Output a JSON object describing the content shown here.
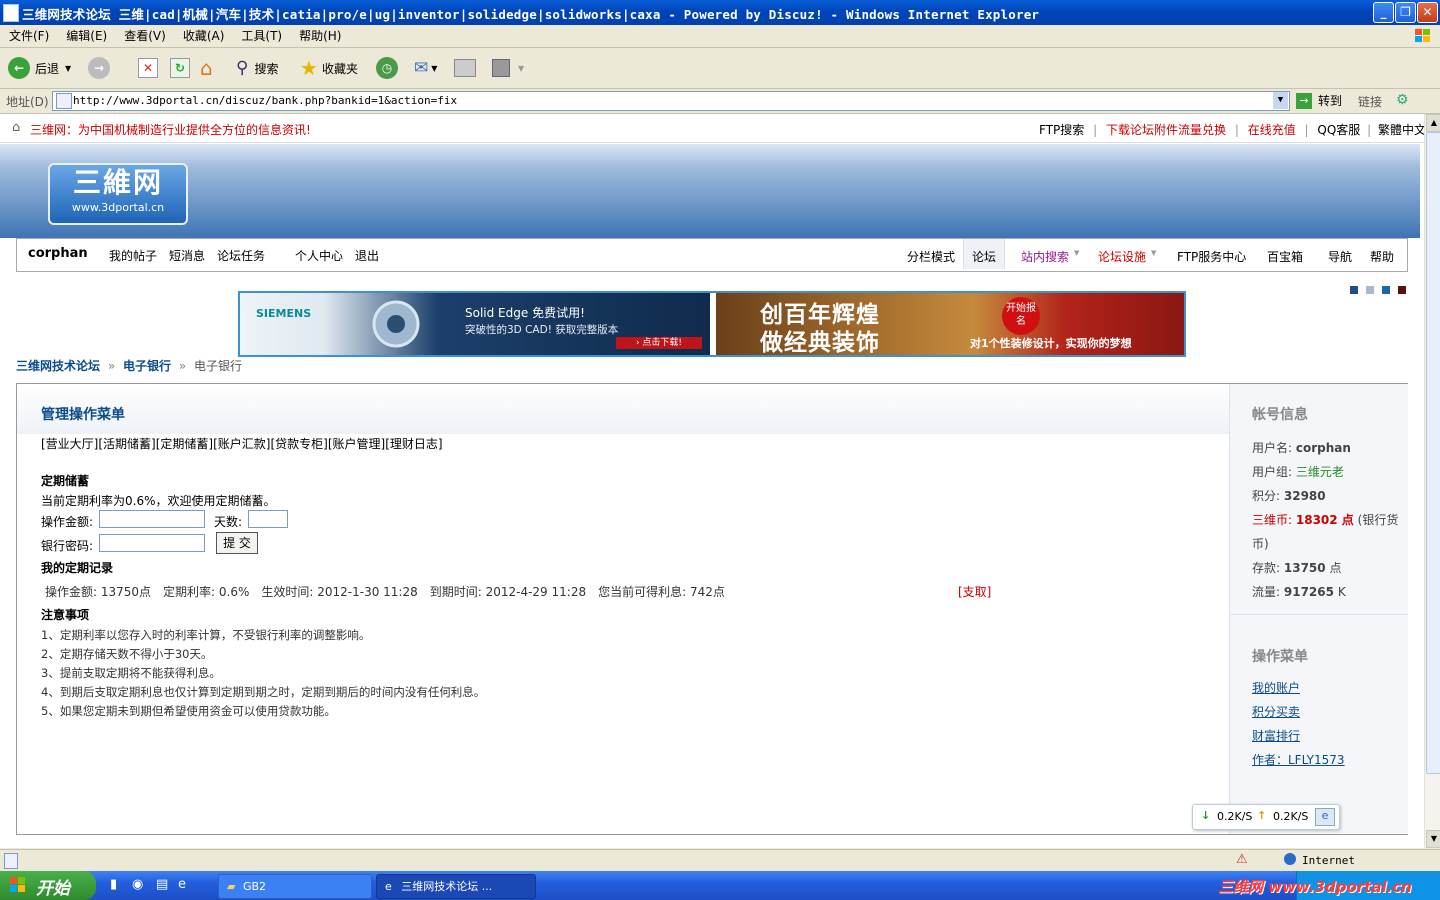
{
  "window": {
    "title": "三维网技术论坛 三维|cad|机械|汽车|技术|catia|pro/e|ug|inventor|solidedge|solidworks|caxa - Powered by Discuz! - Windows Internet Explorer",
    "minimize": "_",
    "maximize": "❐",
    "close": "✕"
  },
  "menu": [
    "文件(F)",
    "编辑(E)",
    "查看(V)",
    "收藏(A)",
    "工具(T)",
    "帮助(H)"
  ],
  "toolbar": {
    "back": "后退",
    "search": "搜索",
    "favorites": "收藏夹"
  },
  "address": {
    "label": "地址(D)",
    "url": "http://www.3dportal.cn/discuz/bank.php?bankid=1&action=fix",
    "go": "转到",
    "links": "链接"
  },
  "site": {
    "slogan": "三维网：为中国机械制造行业提供全方位的信息资讯!",
    "top_links": [
      "FTP搜索",
      "下载论坛附件流量兑换",
      "在线充值",
      "QQ客服",
      "繁體中文"
    ],
    "logo_big": "三維网",
    "logo_small": "www.3dportal.cn",
    "nav": {
      "user": "corphan",
      "left": [
        "我的帖子",
        "短消息",
        "论坛任务",
        "个人中心",
        "退出"
      ],
      "right": [
        "分栏模式",
        "论坛",
        "站内搜索",
        "论坛设施",
        "FTP服务中心",
        "百宝箱",
        "导航",
        "帮助"
      ]
    },
    "banner": {
      "siemens": "SIEMENS",
      "ad1_title": "Solid Edge 免费试用!",
      "ad1_sub": "突破性的3D CAD! 获取完整版本",
      "ad1_btn": "› 点击下载!",
      "ad2_line1": "创百年辉煌",
      "ad2_line2": "做经典装饰",
      "ad2_badge": "开始报名",
      "ad2_tagline": "对1个性装修设计，实现你的梦想"
    },
    "breadcrumb": [
      "三维网技术论坛",
      "电子银行",
      "电子银行"
    ],
    "breadcrumb_sep": "»",
    "panel": {
      "title": "管理操作菜单",
      "menu": [
        "[营业大厅]",
        "[活期储蓄]",
        "[定期储蓄]",
        "[账户汇款]",
        "[贷款专柜]",
        "[账户管理]",
        "[理财日志]"
      ],
      "section_title": "定期储蓄",
      "rate_text": "当前定期利率为0.6%，欢迎使用定期储蓄。",
      "amount_label": "操作金额:",
      "days_label": "天数:",
      "password_label": "银行密码:",
      "submit": "提 交",
      "records_title": "我的定期记录",
      "record": "操作金额: 13750点　定期利率: 0.6%　生效时间: 2012-1-30 11:28　到期时间: 2012-4-29 11:28　您当前可得利息: 742点",
      "withdraw": "[支取]",
      "notes_title": "注意事项",
      "notes": [
        "1、定期利率以您存入时的利率计算，不受银行利率的调整影响。",
        "2、定期存储天数不得小于30天。",
        "3、提前支取定期将不能获得利息。",
        "4、到期后支取定期利息也仅计算到定期到期之时，定期到期后的时间内没有任何利息。",
        "5、如果您定期未到期但希望使用资金可以使用贷款功能。"
      ]
    },
    "sidebar": {
      "account_title": "帐号信息",
      "username_label": "用户名:",
      "username": "corphan",
      "group_label": "用户组:",
      "group": "三维元老",
      "points_label": "积分:",
      "points": "32980",
      "coins_label": "三维币:",
      "coins": "18302 点",
      "coins_note": "(银行货币)",
      "deposit_label": "存款:",
      "deposit": "13750",
      "deposit_unit": "点",
      "traffic_label": "流量:",
      "traffic": "917265",
      "traffic_unit": "K",
      "ops_title": "操作菜单",
      "ops": [
        "我的账户",
        "积分买卖",
        "财富排行",
        "作者：LFLY1573"
      ]
    },
    "speed": {
      "down": "0.2K/S",
      "up": "0.2K/S"
    }
  },
  "status": {
    "zone": "Internet"
  },
  "taskbar": {
    "start": "开始",
    "tasks": [
      "GB2",
      "三维网技术论坛 ..."
    ],
    "watermark": "三维网 www.3dportal.cn"
  },
  "colors": {
    "link": "#0b4c8c",
    "accent_red": "#cc0000",
    "header_blue": "#3f74b5"
  }
}
